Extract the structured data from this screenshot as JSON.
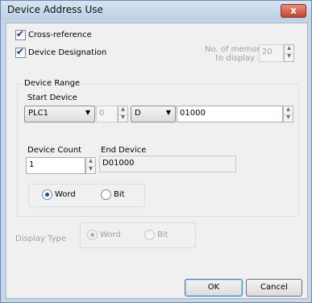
{
  "window": {
    "title": "Device Address Use",
    "close_glyph": "x"
  },
  "options": {
    "cross_reference": {
      "label": "Cross-reference",
      "checked": true
    },
    "device_designation": {
      "label": "Device Designation",
      "checked": true
    },
    "memories": {
      "label_line1": "No. of memories",
      "label_line2": "to display",
      "value": "20"
    }
  },
  "device_range": {
    "title": "Device Range",
    "start_device": {
      "label": "Start Device",
      "plc": "PLC1",
      "station": "0",
      "device_type": "D",
      "address": "01000"
    },
    "device_count": {
      "label": "Device Count",
      "value": "1"
    },
    "end_device": {
      "label": "End Device",
      "value": "D01000"
    },
    "units": {
      "word": "Word",
      "bit": "Bit",
      "selected": "Word"
    }
  },
  "display_type": {
    "label": "Display Type",
    "word": "Word",
    "bit": "Bit",
    "selected": "Word"
  },
  "buttons": {
    "ok": "OK",
    "cancel": "Cancel"
  },
  "colors": {
    "accent": "#1c4f94",
    "title_bar": "#c7d6e6",
    "close": "#c2432c"
  },
  "icons": {
    "checkmark": "✔",
    "dropdown": "▼",
    "spin_up": "▲",
    "spin_down": "▼"
  }
}
